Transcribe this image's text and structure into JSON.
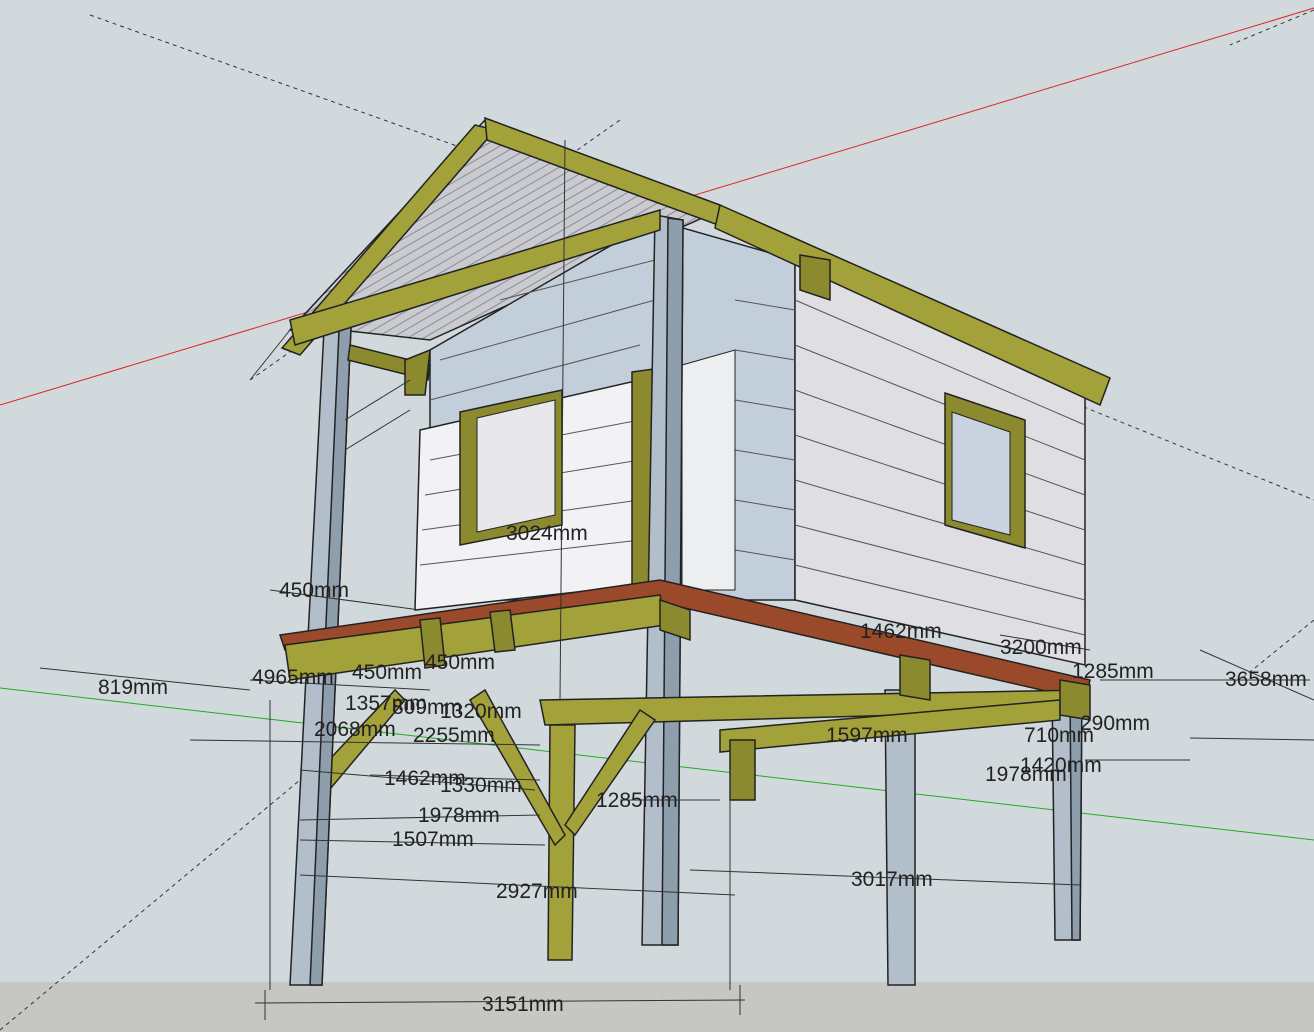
{
  "dimensions": [
    "3024mm",
    "450mm",
    "1462mm",
    "3200mm",
    "1285mm",
    "3658mm",
    "819mm",
    "4965mm",
    "450mm",
    "450mm",
    "1357mm",
    "809mm",
    "1320mm",
    "2068mm",
    "2255mm",
    "1597mm",
    "710mm",
    "290mm",
    "1420mm",
    "1978mm",
    "1462mm",
    "1330mm",
    "1285mm",
    "1978mm",
    "1507mm",
    "2927mm",
    "3017mm",
    "3151mm"
  ],
  "colors": {
    "background": "#d2d9dd",
    "ground": "#c6c6c2",
    "timber": "#8c8a2e",
    "post": "#b2bfcb",
    "deck": "#9a4a2a",
    "wall": "#f2f2f4",
    "red_axis": "#dd2222",
    "green_axis": "#22aa22"
  }
}
